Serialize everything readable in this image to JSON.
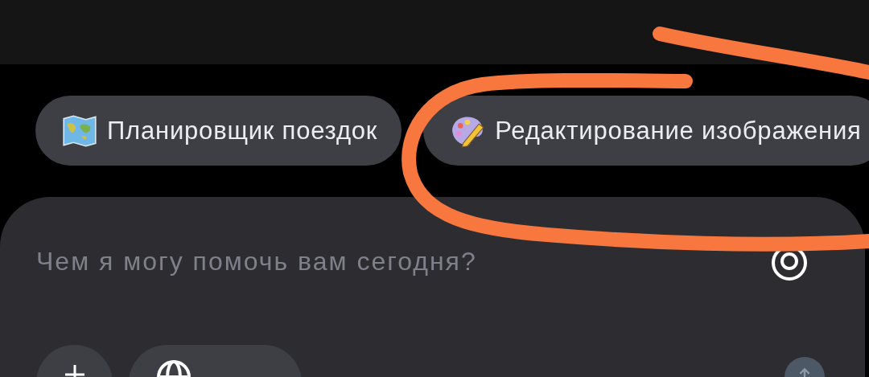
{
  "suggestions": [
    {
      "label": "Планировщик поездок"
    },
    {
      "label": "Редактирование изображения"
    }
  ],
  "composer": {
    "placeholder": "Чем я могу помочь вам сегодня?"
  }
}
